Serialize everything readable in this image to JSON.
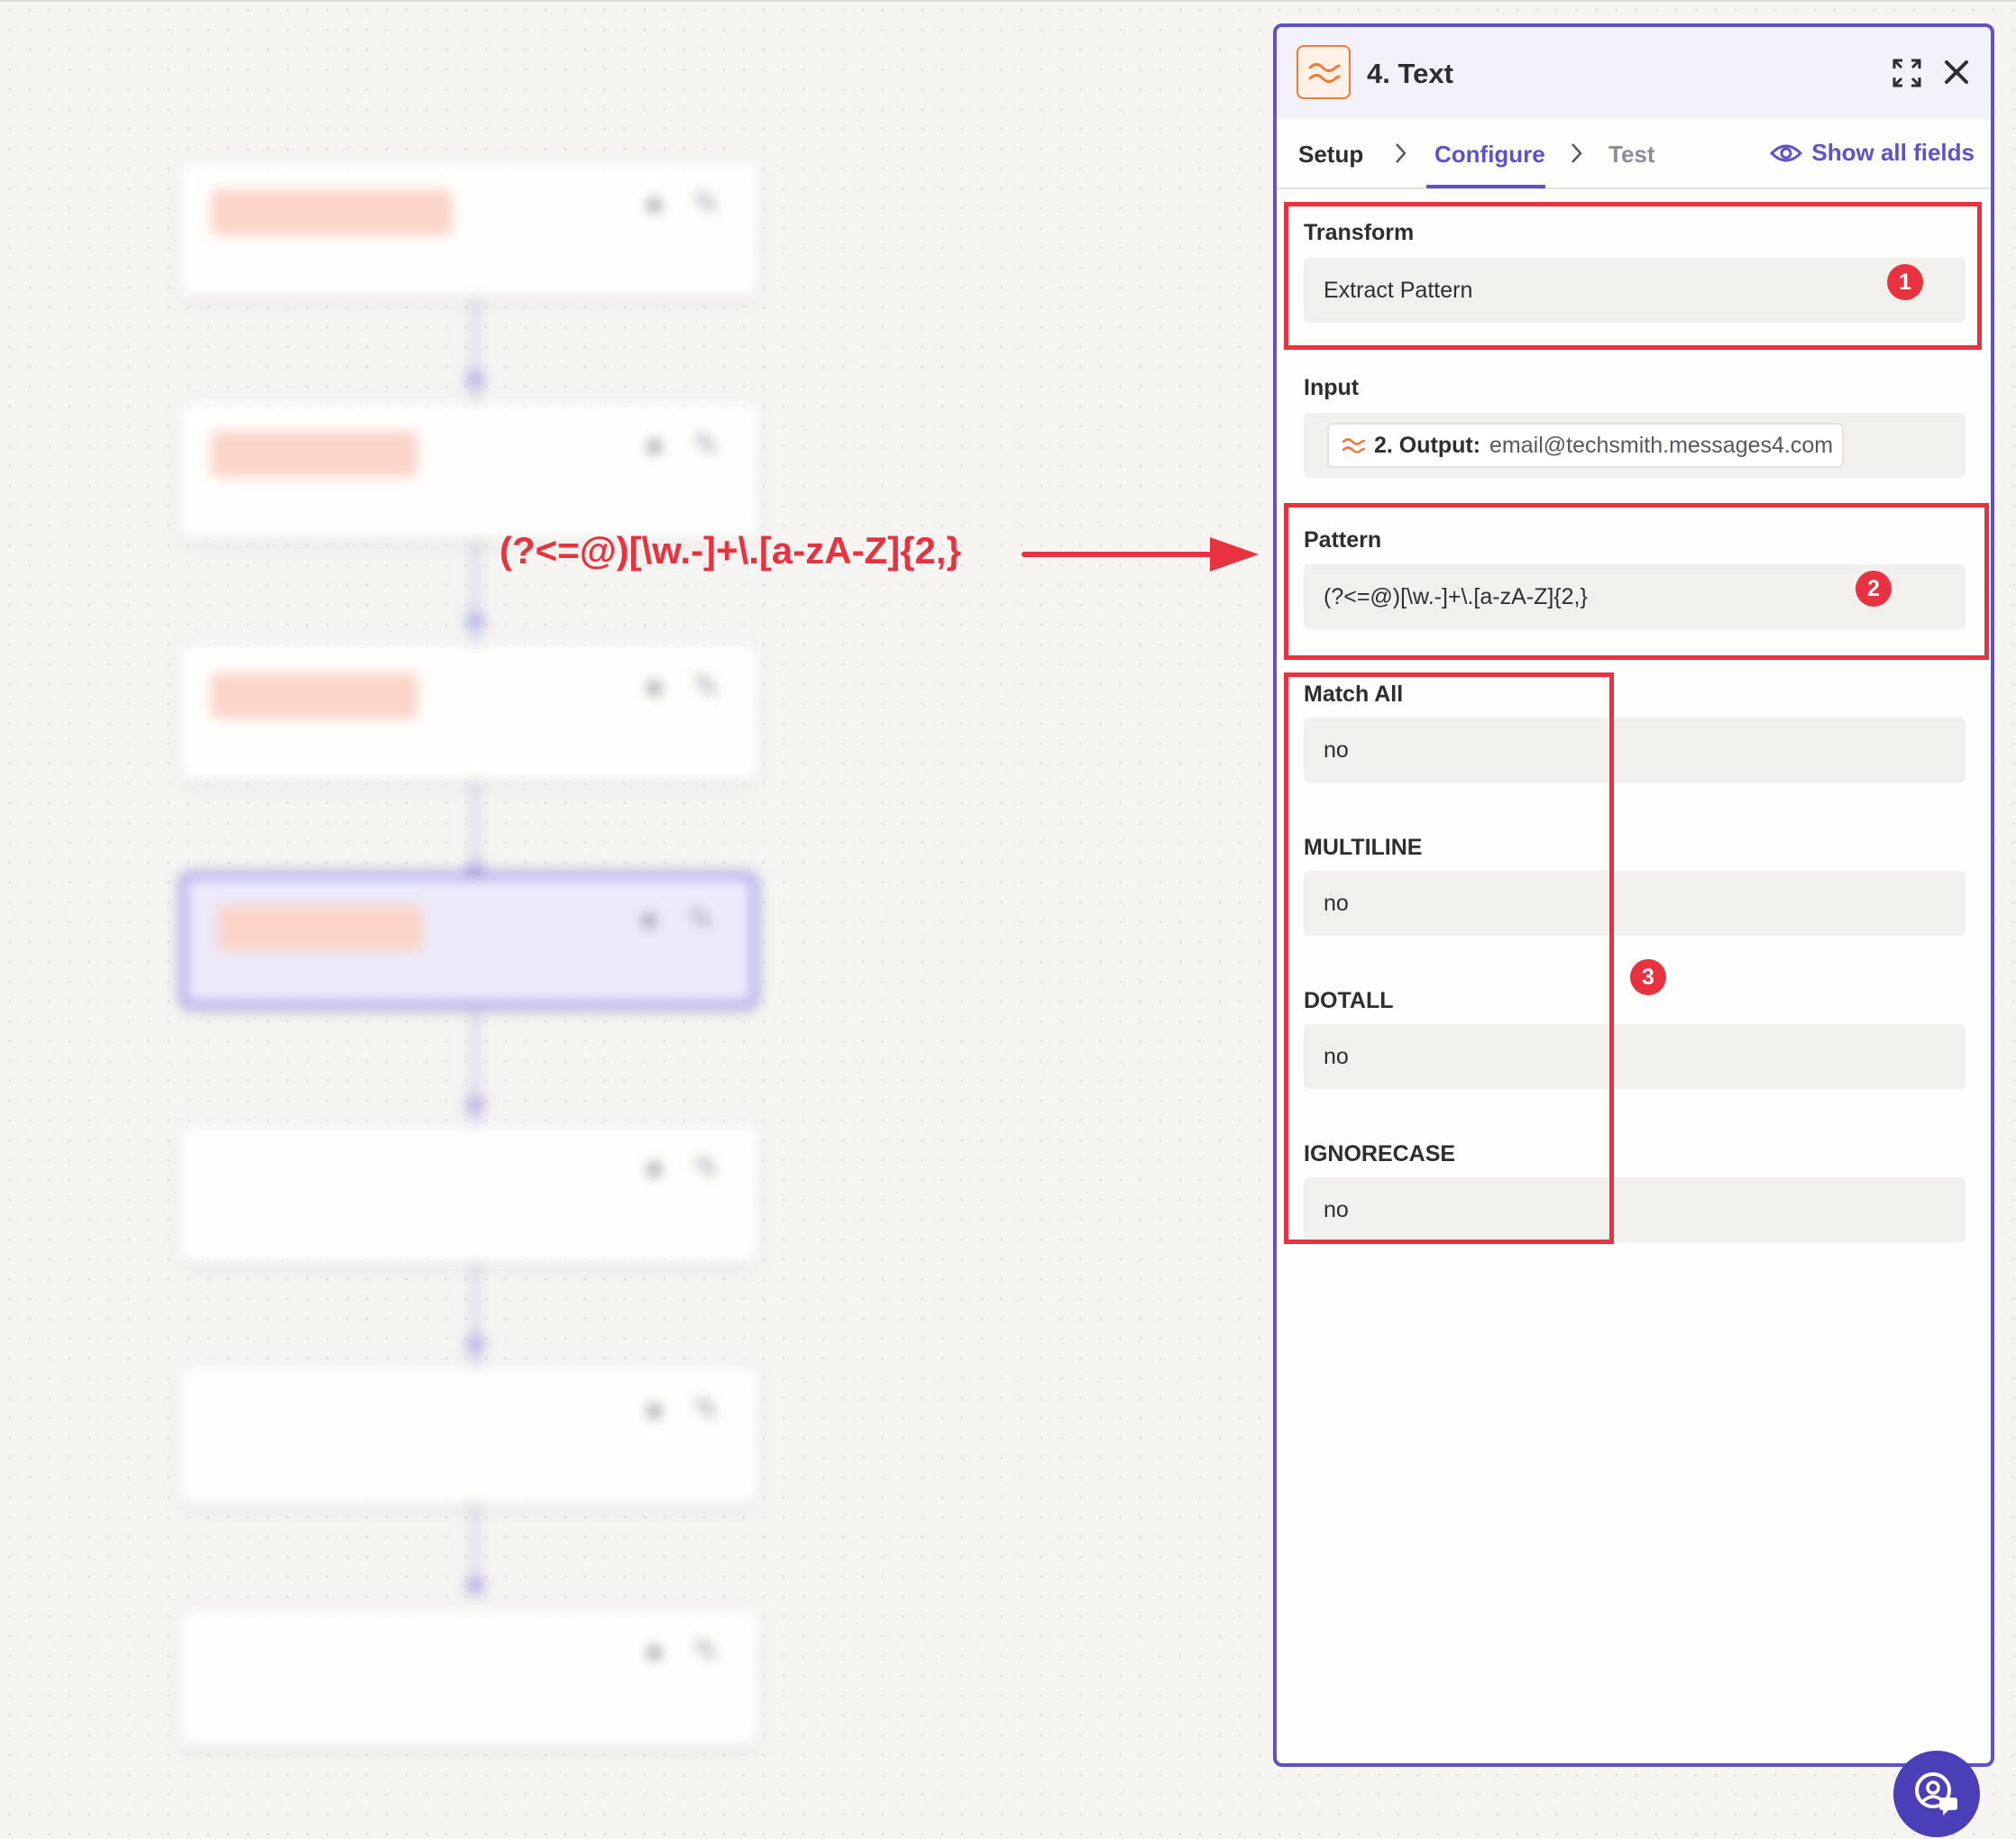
{
  "panel": {
    "title": "4. Text",
    "icons": {
      "app": "text-transform-icon",
      "expand": "expand-icon",
      "close": "close-icon"
    }
  },
  "tabs": {
    "setup": "Setup",
    "configure": "Configure",
    "test": "Test",
    "active": "Configure"
  },
  "show_all_fields": "Show all fields",
  "fields": {
    "transform": {
      "label": "Transform",
      "value": "Extract Pattern"
    },
    "input": {
      "label": "Input",
      "chip_key": "2. Output:",
      "chip_value": "email@techsmith.messages4.com"
    },
    "pattern": {
      "label": "Pattern",
      "value": "(?<=@)[\\w.-]+\\.[a-zA-Z]{2,}"
    },
    "match_all": {
      "label": "Match All",
      "value": "no"
    },
    "multiline": {
      "label": "MULTILINE",
      "value": "no"
    },
    "dotall": {
      "label": "DOTALL",
      "value": "no"
    },
    "ignorecase": {
      "label": "IGNORECASE",
      "value": "no"
    }
  },
  "annotations": {
    "pattern_text": "(?<=@)[\\w.-]+\\.[a-zA-Z]{2,}",
    "badges": [
      "1",
      "2",
      "3"
    ]
  },
  "colors": {
    "accent": "#5d52c9",
    "annotation_red": "#e8323f",
    "app_orange": "#f07a3a"
  }
}
